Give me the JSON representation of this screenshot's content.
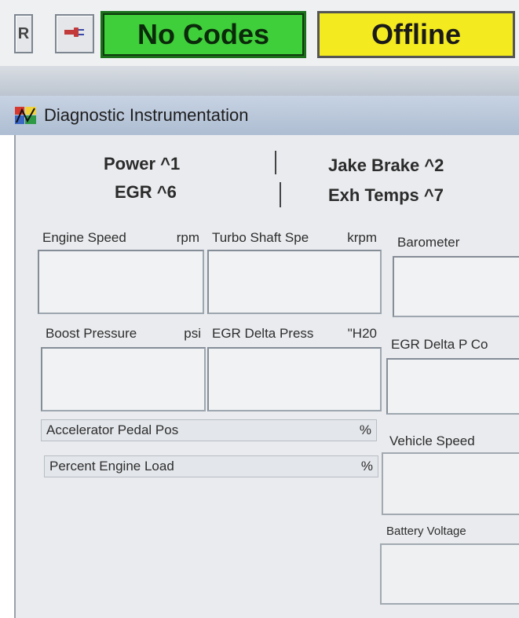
{
  "toolbar": {
    "reset_label": "R",
    "connect_icon": "plug-disconnect-icon",
    "codes_status": "No Codes",
    "connection_status": "Offline",
    "colors": {
      "codes": "#3fcf3a",
      "connection": "#f3ea1f"
    }
  },
  "window": {
    "title": "Diagnostic Instrumentation",
    "icon": "instrument-icon"
  },
  "tabs": {
    "left_top": "Power ^1",
    "left_bottom": "EGR ^6",
    "right_top": "Jake Brake ^2",
    "right_bottom": "Exh Temps ^7"
  },
  "gauges": {
    "engine_speed": {
      "label": "Engine Speed",
      "unit": "rpm"
    },
    "turbo_shaft": {
      "label": "Turbo Shaft Spe",
      "unit": "krpm"
    },
    "barometer": {
      "label": "Barometer"
    },
    "boost_pressure": {
      "label": "Boost Pressure",
      "unit": "psi"
    },
    "egr_delta_press": {
      "label": "EGR Delta Press",
      "unit": "\"H20"
    },
    "egr_delta_p_co": {
      "label": "EGR Delta P Co"
    },
    "accelerator_pedal": {
      "label": "Accelerator Pedal Pos",
      "unit": "%"
    },
    "percent_engine_load": {
      "label": "Percent Engine Load",
      "unit": "%"
    },
    "vehicle_speed": {
      "label": "Vehicle Speed"
    },
    "battery_voltage": {
      "label": "Battery Voltage"
    }
  }
}
